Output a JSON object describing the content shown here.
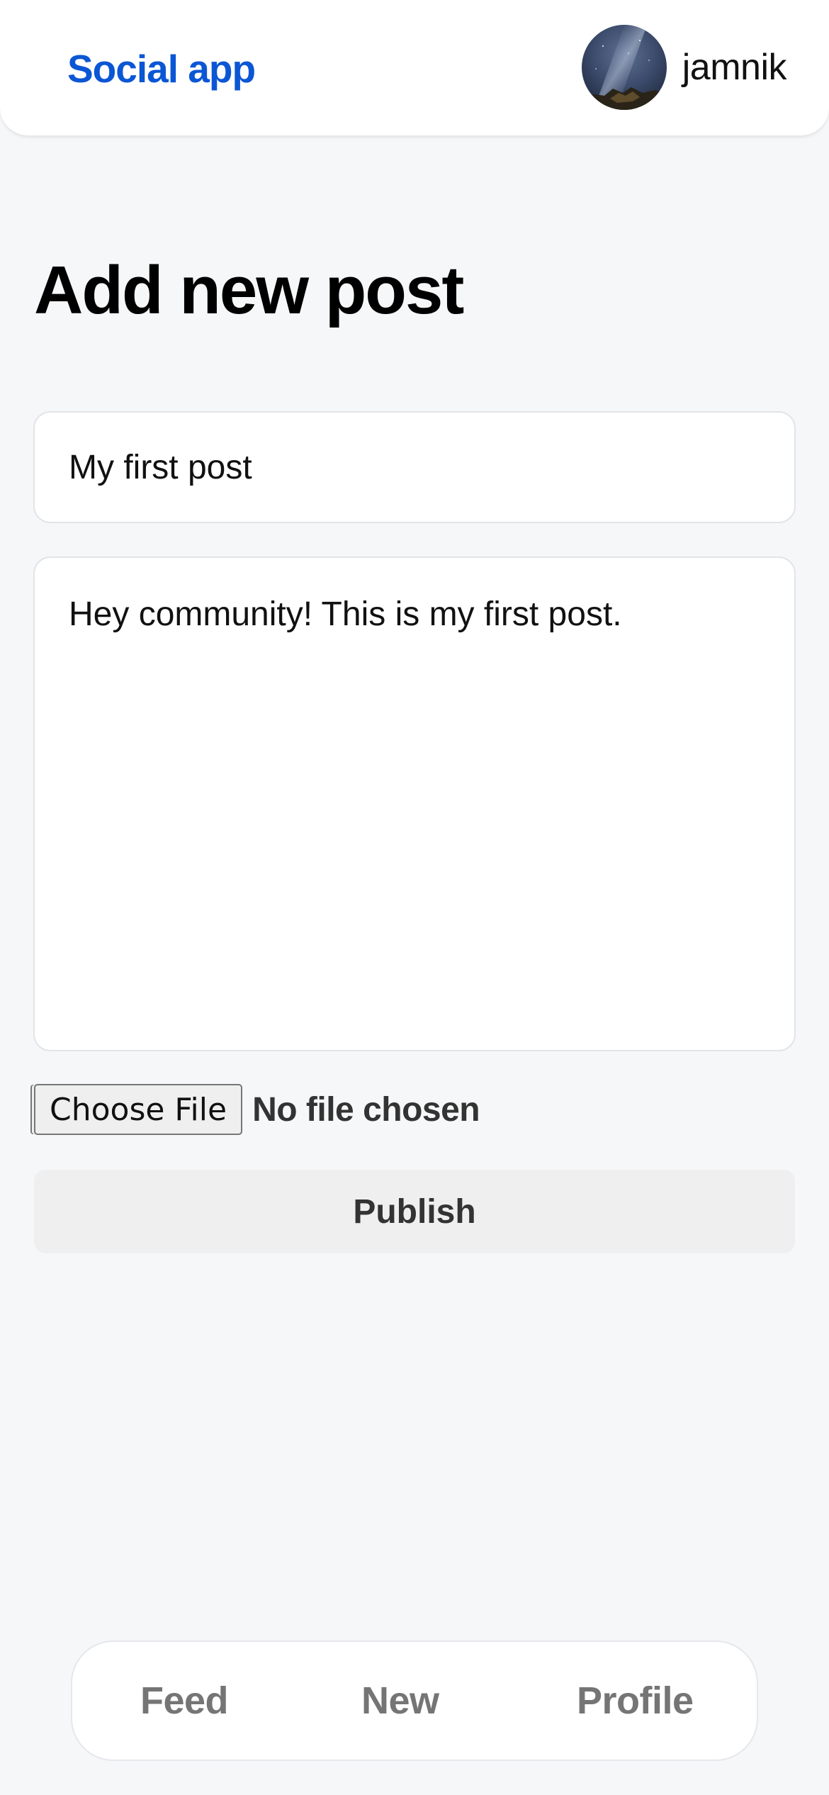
{
  "header": {
    "brand": "Social app",
    "username": "jamnik",
    "brand_color": "#0b56d4"
  },
  "page": {
    "title": "Add new post"
  },
  "form": {
    "title_value": "My first post",
    "body_value": "Hey community! This is my first post.",
    "file_button_label": "Choose File",
    "file_status": "No file chosen",
    "publish_label": "Publish"
  },
  "nav": {
    "items": [
      {
        "label": "Feed"
      },
      {
        "label": "New"
      },
      {
        "label": "Profile"
      }
    ]
  },
  "icons": {
    "avatar": "avatar-image-night-sky"
  }
}
